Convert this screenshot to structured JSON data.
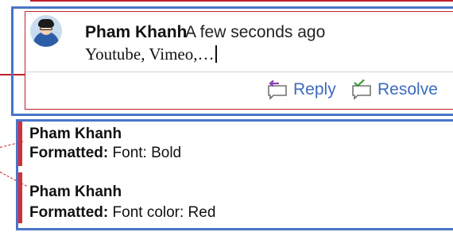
{
  "comment": {
    "author": "Pham Khanh",
    "time": "A few seconds ago",
    "text": "Youtube, Vimeo,…",
    "reply_label": "Reply",
    "resolve_label": "Resolve"
  },
  "formatting_changes": [
    {
      "author": "Pham Khanh",
      "label": "Formatted:",
      "detail": "Font: Bold"
    },
    {
      "author": "Pham Khanh",
      "label": "Formatted:",
      "detail": "Font color: Red"
    }
  ],
  "colors": {
    "card_border": "#4a74c8",
    "tracked_change": "#c0202a",
    "link": "#3b6cbf"
  },
  "icons": [
    "reply-icon",
    "resolve-icon",
    "avatar"
  ]
}
